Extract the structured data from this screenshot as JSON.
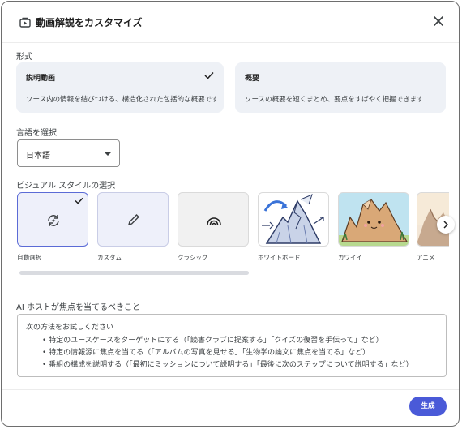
{
  "dialog": {
    "title": "動画解説をカスタマイズ",
    "icon": "video-overview-icon"
  },
  "format": {
    "label": "形式",
    "options": [
      {
        "title": "説明動画",
        "description": "ソース内の情報を結びつける、構造化された包括的な概要です",
        "selected": true
      },
      {
        "title": "概要",
        "description": "ソースの概要を短くまとめ、要点をすばやく把握できます",
        "selected": false
      }
    ]
  },
  "language": {
    "label": "言語を選択",
    "value": "日本語"
  },
  "visual_style": {
    "label": "ビジュアル スタイルの選択",
    "tiles": [
      {
        "label": "自動選択",
        "icon": "auto-refresh-icon",
        "selected": true
      },
      {
        "label": "カスタム",
        "icon": "pencil-icon",
        "selected": false
      },
      {
        "label": "クラシック",
        "icon": "rainbow-icon",
        "selected": false
      },
      {
        "label": "ホワイトボード",
        "icon": "whiteboard-preview",
        "selected": false
      },
      {
        "label": "カワイイ",
        "icon": "kawaii-preview",
        "selected": false
      },
      {
        "label": "アニメ",
        "icon": "anime-preview",
        "selected": false
      }
    ]
  },
  "focus": {
    "label": "AI ホストが焦点を当てるべきこと",
    "placeholder_lines": [
      "次の方法をお試しください",
      "• 特定のユースケースをターゲットにする（「読書クラブに提案する」「クイズの復習を手伝って」など）",
      "• 特定の情報源に焦点を当てる（「アルバムの写真を見せる」「生物学の論文に焦点を当てる」など）",
      "• 番組の構成を説明する（「最初にミッションについて説明する」「最後に次のステップについて説明する」など）"
    ]
  },
  "actions": {
    "generate": "生成"
  },
  "colors": {
    "accent": "#4a5ad8",
    "selected_border": "#5b6bd6",
    "card_bg": "#eef1f6"
  }
}
